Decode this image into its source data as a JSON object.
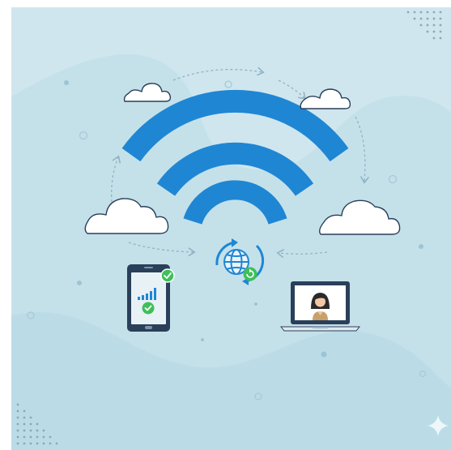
{
  "illustration": {
    "icons": [
      "wifi-icon",
      "cloud-icon",
      "globe-sync-icon",
      "smartphone-icon",
      "signal-bars-icon",
      "check-badge-icon",
      "laptop-icon",
      "user-avatar-icon",
      "sparkle-icon"
    ],
    "colors": {
      "background": "#cfe6ee",
      "background_wave": "#b7dbe7",
      "wifi_blue": "#1f86d4",
      "device_navy": "#2a3f5a",
      "check_green": "#3fbf5a",
      "cloud_fill": "#ffffff",
      "cloud_outline": "#2a3f5a"
    }
  }
}
